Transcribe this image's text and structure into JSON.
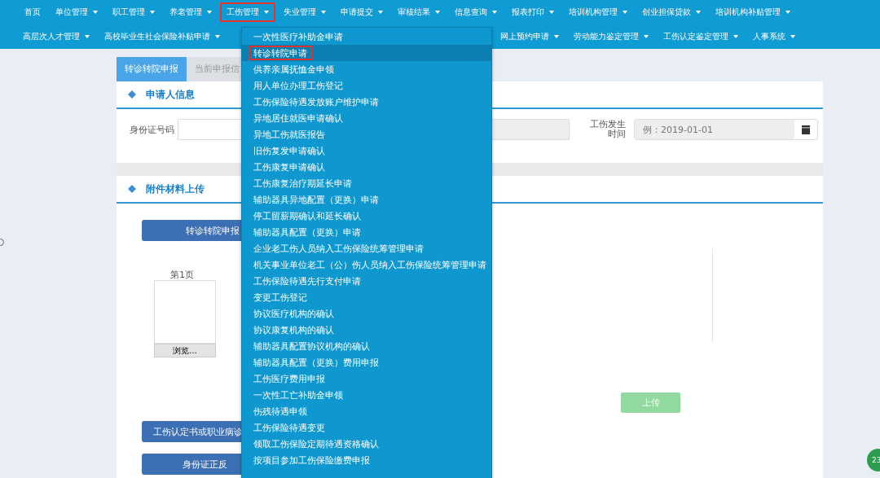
{
  "nav_row1": [
    {
      "label": "首页",
      "caret": false,
      "selected": false
    },
    {
      "label": "单位管理",
      "caret": true,
      "selected": false
    },
    {
      "label": "职工管理",
      "caret": true,
      "selected": false
    },
    {
      "label": "养老管理",
      "caret": true,
      "selected": false
    },
    {
      "label": "工伤管理",
      "caret": true,
      "selected": true
    },
    {
      "label": "失业管理",
      "caret": true,
      "selected": false
    },
    {
      "label": "申请提交",
      "caret": true,
      "selected": false
    },
    {
      "label": "审核结果",
      "caret": true,
      "selected": false
    },
    {
      "label": "信息查询",
      "caret": true,
      "selected": false
    },
    {
      "label": "报表打印",
      "caret": true,
      "selected": false
    },
    {
      "label": "培训机构管理",
      "caret": true,
      "selected": false
    },
    {
      "label": "创业担保贷款",
      "caret": true,
      "selected": false
    },
    {
      "label": "培训机构补贴管理",
      "caret": true,
      "selected": false
    }
  ],
  "nav_row2_left": [
    {
      "label": "高层次人才管理",
      "caret": true,
      "selected": false
    },
    {
      "label": "高校毕业生社会保险补贴申请",
      "caret": true,
      "selected": false
    }
  ],
  "nav_row2_right": [
    {
      "label": "网上预约申请",
      "caret": true,
      "selected": false
    },
    {
      "label": "劳动能力鉴定管理",
      "caret": true,
      "selected": false
    },
    {
      "label": "工伤认定鉴定管理",
      "caret": true,
      "selected": false
    },
    {
      "label": "人事系统",
      "caret": true,
      "selected": false
    }
  ],
  "dropdown": [
    {
      "label": "一次性医疗补助金申请",
      "selected": false
    },
    {
      "label": "转诊转院申请",
      "selected": true
    },
    {
      "label": "供养亲属抚恤金申领",
      "selected": false
    },
    {
      "label": "用人单位办理工伤登记",
      "selected": false
    },
    {
      "label": "工伤保险待遇发放账户维护申请",
      "selected": false
    },
    {
      "label": "异地居住就医申请确认",
      "selected": false
    },
    {
      "label": "异地工伤就医报告",
      "selected": false
    },
    {
      "label": "旧伤复发申请确认",
      "selected": false
    },
    {
      "label": "工伤康复申请确认",
      "selected": false
    },
    {
      "label": "工伤康复治疗期延长申请",
      "selected": false
    },
    {
      "label": "辅助器具异地配置（更换）申请",
      "selected": false
    },
    {
      "label": "停工留薪期确认和延长确认",
      "selected": false
    },
    {
      "label": "辅助器具配置（更换）申请",
      "selected": false
    },
    {
      "label": "企业老工伤人员纳入工伤保险统筹管理申请",
      "selected": false
    },
    {
      "label": "机关事业单位老工（公）伤人员纳入工伤保险统筹管理申请",
      "selected": false
    },
    {
      "label": "工伤保险待遇先行支付申请",
      "selected": false
    },
    {
      "label": "变更工伤登记",
      "selected": false
    },
    {
      "label": "协议医疗机构的确认",
      "selected": false
    },
    {
      "label": "协议康复机构的确认",
      "selected": false
    },
    {
      "label": "辅助器具配置协议机构的确认",
      "selected": false
    },
    {
      "label": "辅助器具配置（更换）费用申报",
      "selected": false
    },
    {
      "label": "工伤医疗费用申报",
      "selected": false
    },
    {
      "label": "一次性工亡补助金申领",
      "selected": false
    },
    {
      "label": "伤残待遇申领",
      "selected": false
    },
    {
      "label": "工伤保险待遇变更",
      "selected": false
    },
    {
      "label": "领取工伤保险定期待遇资格确认",
      "selected": false
    },
    {
      "label": "按项目参加工伤保险缴费申报",
      "selected": false
    }
  ],
  "tabs": [
    {
      "label": "转诊转院申报",
      "selected": true
    },
    {
      "label": "当前申报信",
      "selected": false
    }
  ],
  "applicant": {
    "title": "申请人信息",
    "id_label": "身份证号码",
    "date_label": "工伤发生时间",
    "date_placeholder": "例：2019-01-01"
  },
  "attachments": {
    "title": "附件材料上传",
    "top_button": "转诊转院申报",
    "page_label": "第1页",
    "browse": "浏览...",
    "upload": "上传",
    "bottom_buttons": [
      "工伤认定书或职业病诊",
      "身份证正反"
    ]
  },
  "badge": "23"
}
